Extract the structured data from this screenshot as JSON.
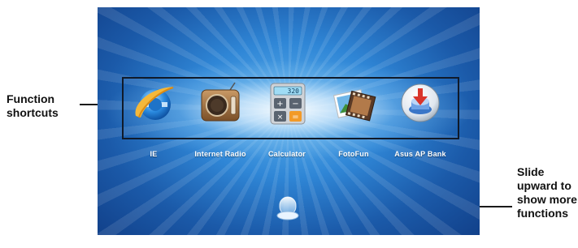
{
  "callouts": {
    "function_shortcuts": "Function shortcuts",
    "slide_up": "Slide upward to show more functions"
  },
  "apps": [
    {
      "label": "IE",
      "icon": "internet-explorer-icon"
    },
    {
      "label": "Internet Radio",
      "icon": "radio-icon"
    },
    {
      "label": "Calculator",
      "icon": "calculator-icon",
      "display": "320"
    },
    {
      "label": "FotoFun",
      "icon": "photo-film-icon"
    },
    {
      "label": "Asus AP Bank",
      "icon": "app-store-download-icon"
    }
  ],
  "colors": {
    "screen_blue": "#2f86d6",
    "ie_blue": "#1e73c8",
    "radio_brown": "#9a6a3c",
    "calc_orange": "#f29a28"
  }
}
